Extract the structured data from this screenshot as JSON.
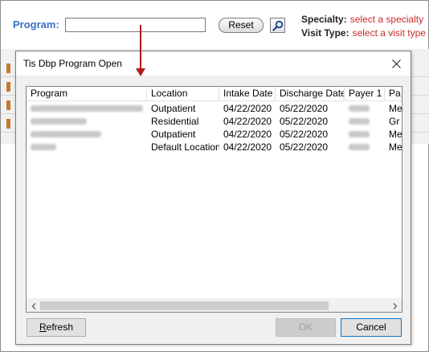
{
  "background": {
    "program_label": "Program:",
    "program_value": "",
    "reset_label": "Reset",
    "specialty_label": "Specialty:",
    "specialty_value": "select a specialty",
    "visit_type_label": "Visit Type:",
    "visit_type_value": "select a visit type",
    "colors": {
      "label_blue": "#3a6fc4",
      "link_red": "#cc2a2a",
      "arrow": "#b01c1c"
    }
  },
  "dialog": {
    "title": "Tis Dbp Program Open",
    "columns": [
      "Program",
      "Location",
      "Intake Date",
      "Discharge Date",
      "Payer 1",
      "Pa"
    ],
    "rows": [
      {
        "location": "Outpatient",
        "intake": "04/22/2020",
        "discharge": "05/22/2020",
        "pa": "Me"
      },
      {
        "location": "Residential",
        "intake": "04/22/2020",
        "discharge": "05/22/2020",
        "pa": "Gr"
      },
      {
        "location": "Outpatient",
        "intake": "04/22/2020",
        "discharge": "05/22/2020",
        "pa": "Me"
      },
      {
        "location": "Default Location",
        "intake": "04/22/2020",
        "discharge": "05/22/2020",
        "pa": "Me"
      }
    ],
    "buttons": {
      "refresh_first": "R",
      "refresh_rest": "efresh",
      "ok": "OK",
      "cancel": "Cancel"
    }
  }
}
